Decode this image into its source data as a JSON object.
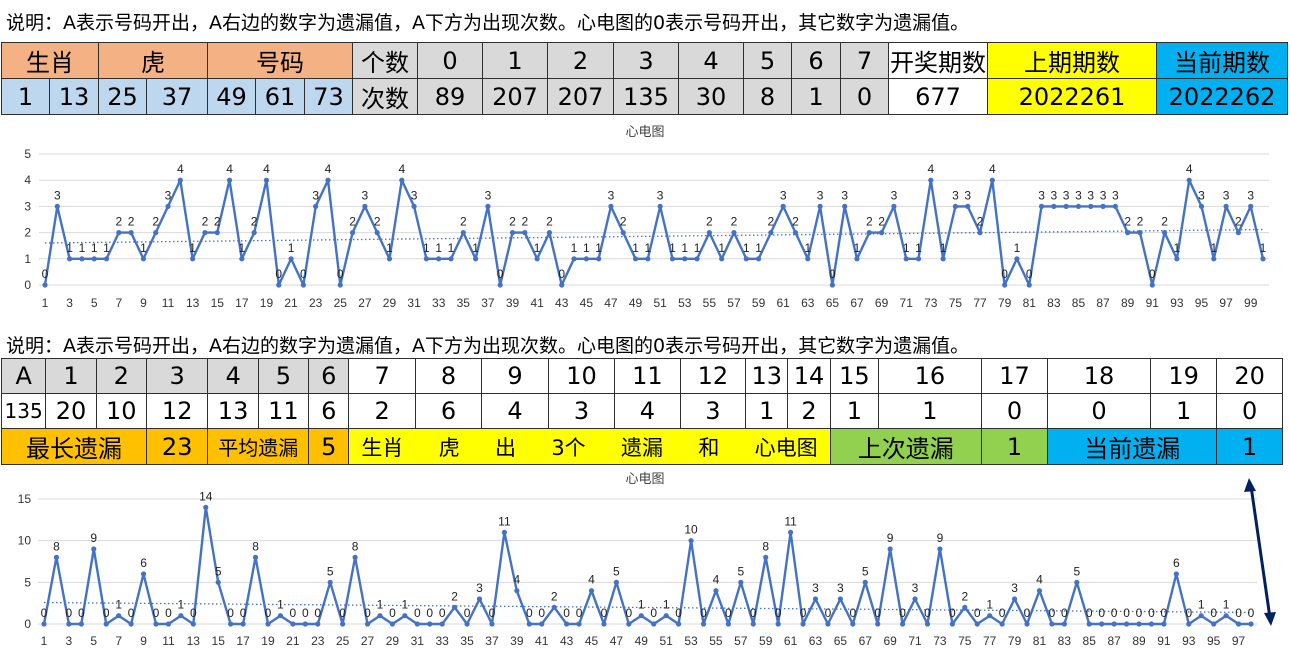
{
  "top_section": {
    "note": "说明：A表示号码开出，A右边的数字为遗漏值，A下方为出现次数。心电图的0表示号码开出，其它数字为遗漏值。",
    "header": {
      "shengxiao_label": "生肖",
      "hu_label": "虎",
      "haoma_label": "号码",
      "geshu_label": "个数",
      "count_keys": [
        "0",
        "1",
        "2",
        "3",
        "4",
        "5",
        "6",
        "7"
      ],
      "kaijiang_label": "开奖期数",
      "prev_label": "上期期数",
      "curr_label": "当前期数"
    },
    "row": {
      "numbers": [
        "1",
        "13",
        "25",
        "37",
        "49",
        "61",
        "73"
      ],
      "cishu_label": "次数",
      "counts": [
        "89",
        "207",
        "207",
        "135",
        "30",
        "8",
        "1",
        "0"
      ],
      "kaijiang_value": "677",
      "prev_value": "2022261",
      "curr_value": "2022262"
    }
  },
  "bottom_section": {
    "note": "说明：A表示号码开出，A右边的数字为遗漏值，A下方为出现次数。心电图的0表示号码开出，其它数字为遗漏值。",
    "header_cells": [
      "A",
      "1",
      "2",
      "3",
      "4",
      "5",
      "6",
      "7",
      "8",
      "9",
      "10",
      "11",
      "12",
      "13",
      "14",
      "15",
      "16",
      "17",
      "18",
      "19",
      "20"
    ],
    "value_cells": [
      "135",
      "20",
      "10",
      "12",
      "13",
      "11",
      "6",
      "2",
      "6",
      "4",
      "3",
      "4",
      "3",
      "1",
      "2",
      "1",
      "1",
      "0",
      "0",
      "1",
      "0"
    ],
    "summary": {
      "longest_label": "最长遗漏",
      "longest_value": "23",
      "avg_label": "平均遗漏",
      "avg_value": "5",
      "desc": [
        "生肖",
        "虎",
        "出",
        "3个",
        "遗漏",
        "和",
        "心电图"
      ],
      "last_label": "上次遗漏",
      "last_value": "1",
      "current_label": "当前遗漏",
      "current_value": "1"
    }
  },
  "colors": {
    "line": "#4472c4",
    "header_orange": "#f4b183",
    "cell_blue": "#bdd7ee",
    "cell_gray": "#d9d9d9",
    "yellow": "#ffff00",
    "cyan": "#00b0f0",
    "gold": "#ffc000",
    "green": "#92d050",
    "arrow": "#002060"
  },
  "chart_data": [
    {
      "type": "line",
      "title": "心电图",
      "x": [
        1,
        2,
        3,
        4,
        5,
        6,
        7,
        8,
        9,
        10,
        11,
        12,
        13,
        14,
        15,
        16,
        17,
        18,
        19,
        20,
        21,
        22,
        23,
        24,
        25,
        26,
        27,
        28,
        29,
        30,
        31,
        32,
        33,
        34,
        35,
        36,
        37,
        38,
        39,
        40,
        41,
        42,
        43,
        44,
        45,
        46,
        47,
        48,
        49,
        50,
        51,
        52,
        53,
        54,
        55,
        56,
        57,
        58,
        59,
        60,
        61,
        62,
        63,
        64,
        65,
        66,
        67,
        68,
        69,
        70,
        71,
        72,
        73,
        74,
        75,
        76,
        77,
        78,
        79,
        80,
        81,
        82,
        83,
        84,
        85,
        86,
        87,
        88,
        89,
        90,
        91,
        92,
        93,
        94,
        95,
        96,
        97,
        98,
        99
      ],
      "values": [
        0,
        3,
        1,
        1,
        1,
        1,
        2,
        2,
        1,
        2,
        3,
        4,
        1,
        2,
        2,
        4,
        1,
        2,
        4,
        0,
        1,
        0,
        3,
        4,
        0,
        2,
        3,
        2,
        1,
        4,
        3,
        1,
        1,
        1,
        2,
        1,
        3,
        0,
        2,
        2,
        1,
        2,
        0,
        1,
        1,
        1,
        3,
        2,
        1,
        1,
        3,
        1,
        1,
        1,
        2,
        1,
        2,
        1,
        1,
        2,
        3,
        2,
        1,
        3,
        0,
        3,
        1,
        2,
        2,
        3,
        1,
        1,
        4,
        1,
        3,
        3,
        2,
        4,
        0,
        1,
        0,
        3,
        3,
        3,
        3,
        3,
        3,
        3,
        2,
        2,
        0,
        2,
        1,
        4,
        3,
        1,
        3,
        2,
        3,
        1
      ],
      "xticks": [
        1,
        3,
        5,
        7,
        9,
        11,
        13,
        15,
        17,
        19,
        21,
        23,
        25,
        27,
        29,
        31,
        33,
        35,
        37,
        39,
        41,
        43,
        45,
        47,
        49,
        51,
        53,
        55,
        57,
        59,
        61,
        63,
        65,
        67,
        69,
        71,
        73,
        75,
        77,
        79,
        81,
        83,
        85,
        87,
        89,
        91,
        93,
        95,
        97,
        99
      ],
      "yticks": [
        0,
        1,
        2,
        3,
        4,
        5
      ],
      "ylim": [
        0,
        5
      ],
      "trendline": "dotted linear",
      "data_labels": true
    },
    {
      "type": "line",
      "title": "心电图",
      "x": [
        1,
        2,
        3,
        4,
        5,
        6,
        7,
        8,
        9,
        10,
        11,
        12,
        13,
        14,
        15,
        16,
        17,
        18,
        19,
        20,
        21,
        22,
        23,
        24,
        25,
        26,
        27,
        28,
        29,
        30,
        31,
        32,
        33,
        34,
        35,
        36,
        37,
        38,
        39,
        40,
        41,
        42,
        43,
        44,
        45,
        46,
        47,
        48,
        49,
        50,
        51,
        52,
        53,
        54,
        55,
        56,
        57,
        58,
        59,
        60,
        61,
        62,
        63,
        64,
        65,
        66,
        67,
        68,
        69,
        70,
        71,
        72,
        73,
        74,
        75,
        76,
        77,
        78,
        79,
        80,
        81,
        82,
        83,
        84,
        85,
        86,
        87,
        88,
        89,
        90,
        91,
        92,
        93,
        94,
        95,
        96,
        97,
        98
      ],
      "values": [
        0,
        8,
        0,
        0,
        9,
        0,
        1,
        0,
        6,
        0,
        0,
        1,
        0,
        14,
        5,
        0,
        0,
        8,
        0,
        1,
        0,
        0,
        0,
        5,
        0,
        8,
        0,
        1,
        0,
        1,
        0,
        0,
        0,
        2,
        0,
        3,
        0,
        11,
        4,
        0,
        0,
        2,
        0,
        0,
        4,
        0,
        5,
        0,
        1,
        0,
        1,
        0,
        10,
        0,
        4,
        0,
        5,
        0,
        8,
        0,
        11,
        0,
        3,
        0,
        3,
        0,
        5,
        0,
        9,
        0,
        3,
        0,
        9,
        0,
        2,
        0,
        1,
        0,
        3,
        0,
        4,
        0,
        0,
        5,
        0,
        0,
        0,
        0,
        0,
        0,
        0,
        6,
        0,
        1,
        0,
        1,
        0,
        0
      ],
      "xticks": [
        1,
        3,
        5,
        7,
        9,
        11,
        13,
        15,
        17,
        19,
        21,
        23,
        25,
        27,
        29,
        31,
        33,
        35,
        37,
        39,
        41,
        43,
        45,
        47,
        49,
        51,
        53,
        55,
        57,
        59,
        61,
        63,
        65,
        67,
        69,
        71,
        73,
        75,
        77,
        79,
        81,
        83,
        85,
        87,
        89,
        91,
        93,
        95,
        97
      ],
      "yticks": [
        0,
        5,
        10,
        15
      ],
      "ylim": [
        0,
        15
      ],
      "trendline": "dotted linear",
      "data_labels": true
    }
  ]
}
